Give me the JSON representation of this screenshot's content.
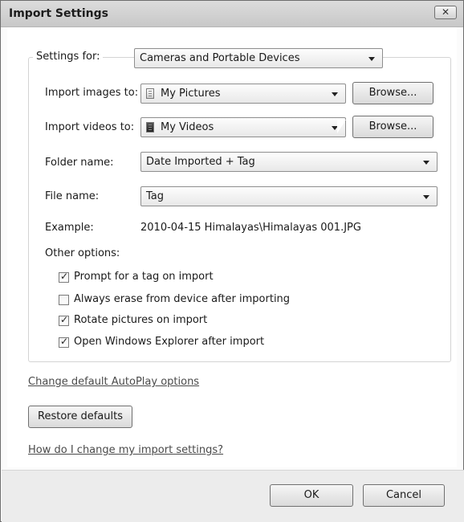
{
  "window": {
    "title": "Import Settings",
    "close_label": "✕"
  },
  "settings_for": {
    "label": "Settings for:",
    "value": "Cameras and Portable Devices"
  },
  "import_images": {
    "label": "Import images to:",
    "value": "My Pictures",
    "browse_label": "Browse..."
  },
  "import_videos": {
    "label": "Import videos to:",
    "value": "My Videos",
    "browse_label": "Browse..."
  },
  "folder_name": {
    "label": "Folder name:",
    "value": "Date Imported + Tag"
  },
  "file_name": {
    "label": "File name:",
    "value": "Tag"
  },
  "example": {
    "label": "Example:",
    "value": "2010-04-15 Himalayas\\Himalayas 001.JPG"
  },
  "other_options": {
    "label": "Other options:",
    "items": [
      {
        "label": "Prompt for a tag on import",
        "checked": true
      },
      {
        "label": "Always erase from device after importing",
        "checked": false
      },
      {
        "label": "Rotate pictures on import",
        "checked": true
      },
      {
        "label": "Open Windows Explorer after import",
        "checked": true
      }
    ]
  },
  "links": {
    "autoplay": "Change default AutoPlay options",
    "help": "How do I change my import settings?"
  },
  "restore_label": "Restore defaults",
  "footer": {
    "ok_label": "OK",
    "cancel_label": "Cancel"
  }
}
